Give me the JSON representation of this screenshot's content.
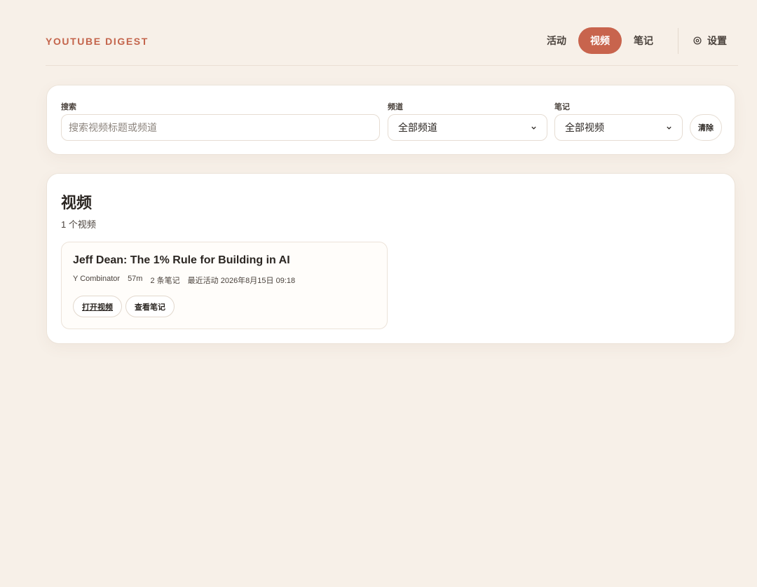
{
  "header": {
    "brand": "YOUTUBE DIGEST",
    "tabs": [
      {
        "label": "活动",
        "active": false
      },
      {
        "label": "视频",
        "active": true
      },
      {
        "label": "笔记",
        "active": false
      }
    ],
    "settings_label": "设置"
  },
  "filters": {
    "search": {
      "label": "搜索",
      "placeholder": "搜索视频标题或频道",
      "value": ""
    },
    "channel": {
      "label": "频道",
      "selected": "全部频道"
    },
    "notes": {
      "label": "笔记",
      "selected": "全部视频"
    },
    "clear_label": "清除"
  },
  "videos": {
    "title": "视频",
    "count": "1 个视频",
    "items": [
      {
        "title": "Jeff Dean: The 1% Rule for Building in AI",
        "channel": "Y Combinator",
        "duration": "57m",
        "notes_count": "2 条笔记",
        "last_activity": "最近活动 2026年8月15日 09:18",
        "open_label": "打开视频",
        "notes_label": "查看笔记"
      }
    ]
  },
  "colors": {
    "accent": "#c8644d",
    "brand": "#c4654c",
    "background": "#f7f0e8",
    "card": "#ffffff"
  }
}
